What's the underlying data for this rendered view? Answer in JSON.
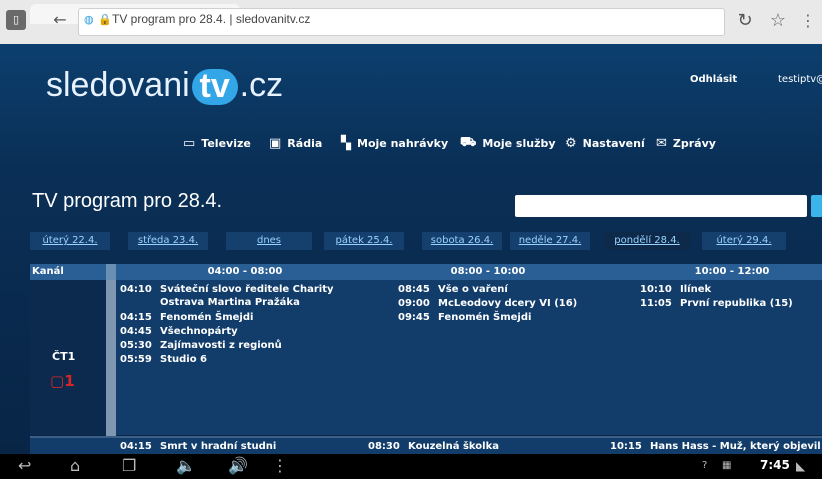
{
  "browser": {
    "url_text": "TV program pro 28.4. | sledovanitv.cz",
    "icons": [
      "tab-icon",
      "back-icon",
      "globe-icon",
      "lock-icon",
      "reload-icon",
      "star-icon",
      "menu-icon"
    ]
  },
  "header": {
    "logo_left": "sledovani",
    "logo_tv": "tv",
    "logo_right": ".cz",
    "logout": "Odhlásit",
    "user": "testiptv@"
  },
  "nav": [
    {
      "label": "Televize",
      "icon": "tv-icon"
    },
    {
      "label": "Rádia",
      "icon": "radio-icon"
    },
    {
      "label": "Moje nahrávky",
      "icon": "recordings-icon"
    },
    {
      "label": "Moje služby",
      "icon": "cart-icon"
    },
    {
      "label": "Nastavení",
      "icon": "gear-icon"
    },
    {
      "label": "Zprávy",
      "icon": "mail-icon"
    }
  ],
  "page": {
    "title": "TV program pro 28.4."
  },
  "days": [
    {
      "label": "úterý 22.4."
    },
    {
      "label": "středa 23.4."
    },
    {
      "label": "dnes"
    },
    {
      "label": "pátek 25.4."
    },
    {
      "label": "sobota 26.4."
    },
    {
      "label": "neděle 27.4."
    },
    {
      "label": "pondělí 28.4."
    },
    {
      "label": "úterý 29.4."
    }
  ],
  "grid": {
    "channel_header": "Kanál",
    "slots": [
      "04:00 - 08:00",
      "08:00 - 10:00",
      "10:00 - 12:00"
    ],
    "channel": {
      "name": "ČT1",
      "logo": "1"
    },
    "row1": {
      "col1": [
        {
          "time": "04:10",
          "title": "Sváteční slovo ředitele Charity"
        },
        {
          "time": "",
          "title": "Ostrava Martina Pražáka"
        },
        {
          "time": "04:15",
          "title": "Fenomén Šmejdi"
        },
        {
          "time": "04:45",
          "title": "Všechnopárty"
        },
        {
          "time": "05:30",
          "title": "Zajímavosti z regionů"
        },
        {
          "time": "05:59",
          "title": "Studio 6"
        }
      ],
      "col2": [
        {
          "time": "08:45",
          "title": "Vše o vaření"
        },
        {
          "time": "09:00",
          "title": "McLeodovy dcery VI (16)"
        },
        {
          "time": "09:45",
          "title": "Fenomén Šmejdi"
        }
      ],
      "col3": [
        {
          "time": "10:10",
          "title": "Ilínek"
        },
        {
          "time": "11:05",
          "title": "První republika (15)"
        }
      ]
    },
    "row2": [
      {
        "time": "04:15",
        "title": "Smrt v hradní studni"
      },
      {
        "time": "08:30",
        "title": "Kouzelná školka"
      },
      {
        "time": "10:15",
        "title": "Hans Hass - Muž, který objevil"
      }
    ]
  },
  "system": {
    "clock": "7:45"
  }
}
